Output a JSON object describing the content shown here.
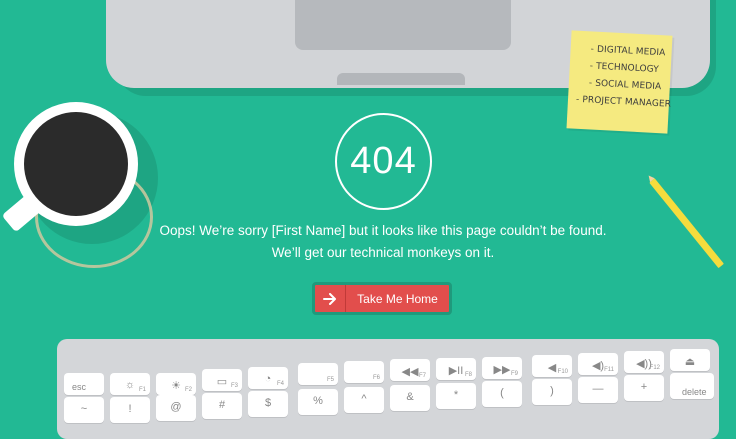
{
  "sticky_note": {
    "items": [
      "- DIGITAL MEDIA",
      "- TECHNOLOGY",
      "- SOCIAL MEDIA",
      "- PROJECT MANAGER"
    ]
  },
  "error": {
    "code": "404",
    "line1": "Oops! We’re sorry [First Name] but it looks like this page couldn’t be found.",
    "line2": "We’ll get our technical monkeys on it."
  },
  "home_button": {
    "label": "Take Me Home",
    "icon": "arrow-right-icon"
  },
  "keyboard": {
    "fn_row": [
      {
        "label": "esc",
        "sub": ""
      },
      {
        "label": "☼",
        "sub": "F1"
      },
      {
        "label": "☀",
        "sub": "F2"
      },
      {
        "label": "▭",
        "sub": "F3"
      },
      {
        "label": "◔",
        "sub": "F4"
      },
      {
        "label": "",
        "sub": "F5"
      },
      {
        "label": "",
        "sub": "F6"
      },
      {
        "label": "◀◀",
        "sub": "F7"
      },
      {
        "label": "▶II",
        "sub": "F8"
      },
      {
        "label": "▶▶",
        "sub": "F9"
      },
      {
        "label": "◀",
        "sub": "F10"
      },
      {
        "label": "◀)",
        "sub": "F11"
      },
      {
        "label": "◀))",
        "sub": "F12"
      },
      {
        "label": "⏏",
        "sub": ""
      }
    ],
    "num_row": [
      "~",
      "!",
      "@",
      "#",
      "$",
      "%",
      "^",
      "&",
      "*",
      "(",
      ")",
      "—",
      "+",
      "delete"
    ]
  },
  "colors": {
    "background": "#22b994",
    "button": "#e24e4c",
    "sticky": "#f5ea80"
  }
}
